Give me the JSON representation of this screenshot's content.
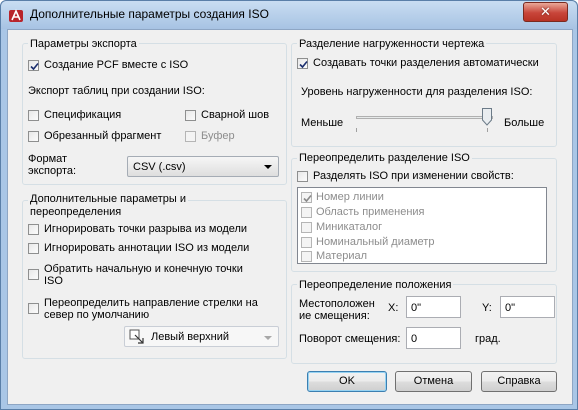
{
  "window": {
    "title": "Дополнительные параметры создания ISO",
    "close_glyph": "✕"
  },
  "export": {
    "title": "Параметры экспорта",
    "create_pcf": {
      "label": "Создание PCF вместе с ISO",
      "checked": true
    },
    "tables_label": "Экспорт таблиц при создании ISO:",
    "spec": {
      "label": "Спецификация",
      "checked": false
    },
    "weld": {
      "label": "Сварной шов",
      "checked": false
    },
    "cut": {
      "label": "Обрезанный фрагмент",
      "checked": false
    },
    "buffer": {
      "label": "Буфер",
      "checked": false,
      "disabled": true
    },
    "format_label_1": "Формат",
    "format_label_2": "экспорта:",
    "format_value": "CSV (.csv)"
  },
  "additional": {
    "title_1": "Дополнительные параметры и",
    "title_2": "переопределения",
    "ignore_breaks": {
      "label": "Игнорировать точки разрыва из модели",
      "checked": false
    },
    "ignore_annot": {
      "label": "Игнорировать аннотации ISO из модели",
      "checked": false
    },
    "reverse_1": "Обратить начальную и конечную точки",
    "reverse_2": "ISO",
    "arrow_1": "Переопределить направление стрелки на",
    "arrow_2": "север по умолчанию",
    "position_value": "Левый верхний"
  },
  "density": {
    "title": "Разделение нагруженности чертежа",
    "auto": {
      "label": "Создавать точки разделения автоматически",
      "checked": true
    },
    "level_label": "Уровень нагруженности для разделения ISO:",
    "less": "Меньше",
    "more": "Больше",
    "level": 1.0
  },
  "split": {
    "title": "Переопределить разделение ISO",
    "on_change": {
      "label": "Разделять ISO при изменении свойств:",
      "checked": false
    },
    "props": [
      {
        "label": "Номер линии",
        "checked": true
      },
      {
        "label": "Область применения",
        "checked": false
      },
      {
        "label": "Миникаталог",
        "checked": false
      },
      {
        "label": "Номинальный диаметр",
        "checked": false
      },
      {
        "label": "Материал",
        "checked": false
      }
    ]
  },
  "position": {
    "title": "Переопределение положения",
    "offset_label_1": "Местоположен",
    "offset_label_2": "ие смещения:",
    "x_label": "X:",
    "x_value": "0\"",
    "y_label": "Y:",
    "y_value": "0\"",
    "rotation_label": "Поворот смещения:",
    "rotation_value": "0",
    "rotation_unit": "град."
  },
  "buttons": {
    "ok": "OK",
    "cancel": "Отмена",
    "help": "Справка"
  }
}
